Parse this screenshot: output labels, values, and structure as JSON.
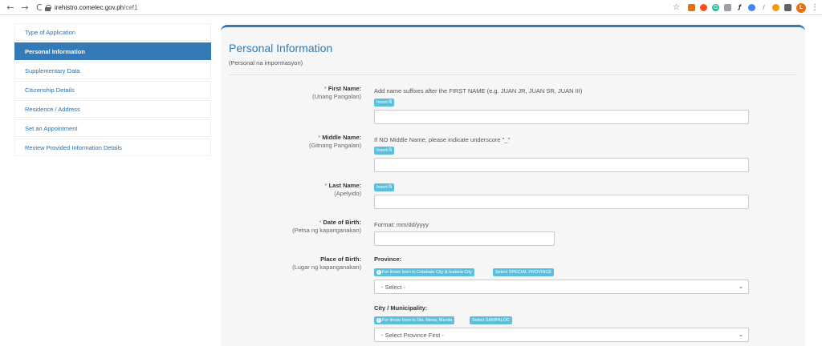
{
  "browser": {
    "back_icon": "←",
    "forward_icon": "→",
    "reload_icon": "C",
    "url_host": "irehistro.comelec.gov.ph",
    "url_path": "/cef1",
    "star_icon": "☆",
    "profile_initial": "L",
    "menu_icon": "⋮",
    "extensions": [
      {
        "name": "ext-1",
        "color": "#e37400",
        "glyph": ""
      },
      {
        "name": "ext-2",
        "color": "#f4511e",
        "glyph": ""
      },
      {
        "name": "ext-3",
        "color": "#15c39a",
        "glyph": "G"
      },
      {
        "name": "ext-4",
        "color": "#9aa0a6",
        "glyph": ""
      },
      {
        "name": "ext-5",
        "color": "#202124",
        "glyph": "ƒ"
      },
      {
        "name": "ext-6",
        "color": "#4285f4",
        "glyph": ""
      },
      {
        "name": "ext-7",
        "color": "#5f6368",
        "glyph": ""
      },
      {
        "name": "ext-8",
        "color": "#f29900",
        "glyph": ""
      },
      {
        "name": "ext-9",
        "color": "#5f6368",
        "glyph": ""
      }
    ]
  },
  "sidebar": {
    "items": [
      {
        "label": "Type of Application"
      },
      {
        "label": "Personal Information"
      },
      {
        "label": "Supplementary Data"
      },
      {
        "label": "Citizenship Details"
      },
      {
        "label": "Residence / Address"
      },
      {
        "label": "Set an Appointment"
      },
      {
        "label": "Review Provided Information Details"
      }
    ],
    "active_index": 1
  },
  "form": {
    "title": "Personal Information",
    "subtitle": "(Personal na impormasyon)",
    "insert_badge": "Insert Ñ",
    "first_name": {
      "asterisk": "*",
      "label": "First Name:",
      "translation": "(Unang Pangalan)",
      "hint": "Add name suffixes after the FIRST NAME (e.g. JUAN JR, JUAN SR, JUAN III)",
      "value": ""
    },
    "middle_name": {
      "asterisk": "*",
      "label": "Middle Name:",
      "translation": "(Gitnang Pangalan)",
      "hint": "If NO Middle Name, please indicate underscore \"_\"",
      "value": ""
    },
    "last_name": {
      "asterisk": "*",
      "label": "Last Name:",
      "translation": "(Apelyido)",
      "value": ""
    },
    "dob": {
      "asterisk": "*",
      "label": "Date of Birth:",
      "translation": "(Petsa ng kapanganakan)",
      "hint": "Format: mm/dd/yyyy",
      "value": ""
    },
    "place_of_birth": {
      "label": "Place of Birth:",
      "translation": "(Lugar ng kapanganakan)",
      "province_label": "Province:",
      "province_info_badge": "For those born in Cotabato City & Isabela City",
      "province_special_button": "Select SPECIAL PROVINCE",
      "province_selected": "- Select -",
      "city_label": "City / Municipality:",
      "city_info_badge": "For those born in Sta. Mesa, Manila",
      "city_sampaloc_button": "Select SAMPALOC",
      "city_selected": "- Select Province First -",
      "info_icon": "i",
      "caret": "⌄"
    }
  }
}
